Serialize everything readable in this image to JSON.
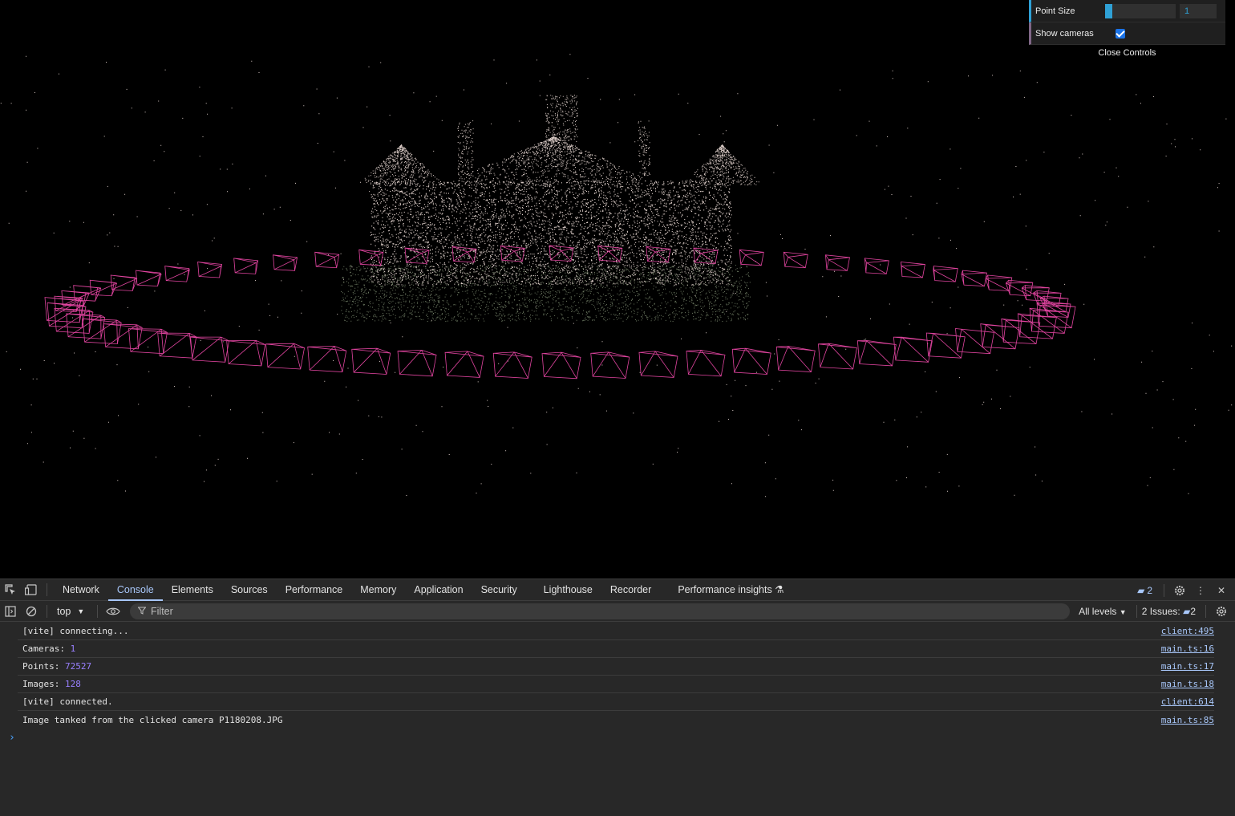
{
  "gui": {
    "point_size_label": "Point Size",
    "point_size_value": "1",
    "point_size_fraction": 0.1,
    "show_cameras_label": "Show cameras",
    "show_cameras_checked": true,
    "close_label": "Close Controls"
  },
  "scene": {
    "camera_color": "#e0449f",
    "background": "#000000"
  },
  "devtools": {
    "tabs": [
      "Network",
      "Console",
      "Elements",
      "Sources",
      "Performance",
      "Memory",
      "Application",
      "Security",
      "Lighthouse",
      "Recorder",
      "Performance insights"
    ],
    "active_tab": "Console",
    "issues_badge": "2",
    "context": "top",
    "filter_placeholder": "Filter",
    "levels": "All levels",
    "issues_label": "2 Issues:",
    "issues_count": "2",
    "messages": [
      {
        "text": "[vite] connecting...",
        "value": "",
        "source": "client:495"
      },
      {
        "text": "Cameras: ",
        "value": "1",
        "source": "main.ts:16"
      },
      {
        "text": "Points: ",
        "value": "72527",
        "source": "main.ts:17"
      },
      {
        "text": "Images: ",
        "value": "128",
        "source": "main.ts:18"
      },
      {
        "text": "[vite] connected.",
        "value": "",
        "source": "client:614"
      },
      {
        "text": "Image tanked from the clicked camera P1180208.JPG",
        "value": "",
        "source": "main.ts:85"
      }
    ],
    "prompt": "›"
  }
}
